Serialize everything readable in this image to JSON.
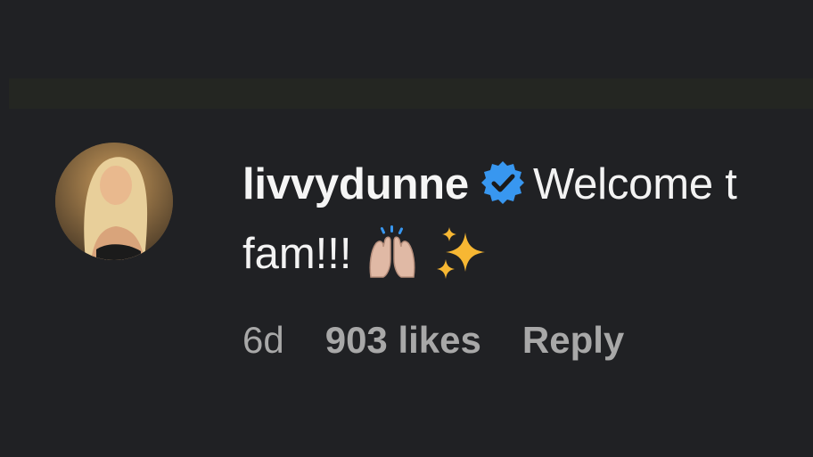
{
  "comment": {
    "username": "livvydunne",
    "verified": true,
    "text_line1": "Welcome t",
    "text_line2": "fam!!!",
    "emojis": [
      "raising-hands-icon",
      "sparkles-icon"
    ],
    "age": "6d",
    "likes": "903 likes",
    "reply_label": "Reply"
  },
  "colors": {
    "background": "#202124",
    "verified_badge": "#3897f0",
    "meta_text": "#a8a8a8"
  }
}
